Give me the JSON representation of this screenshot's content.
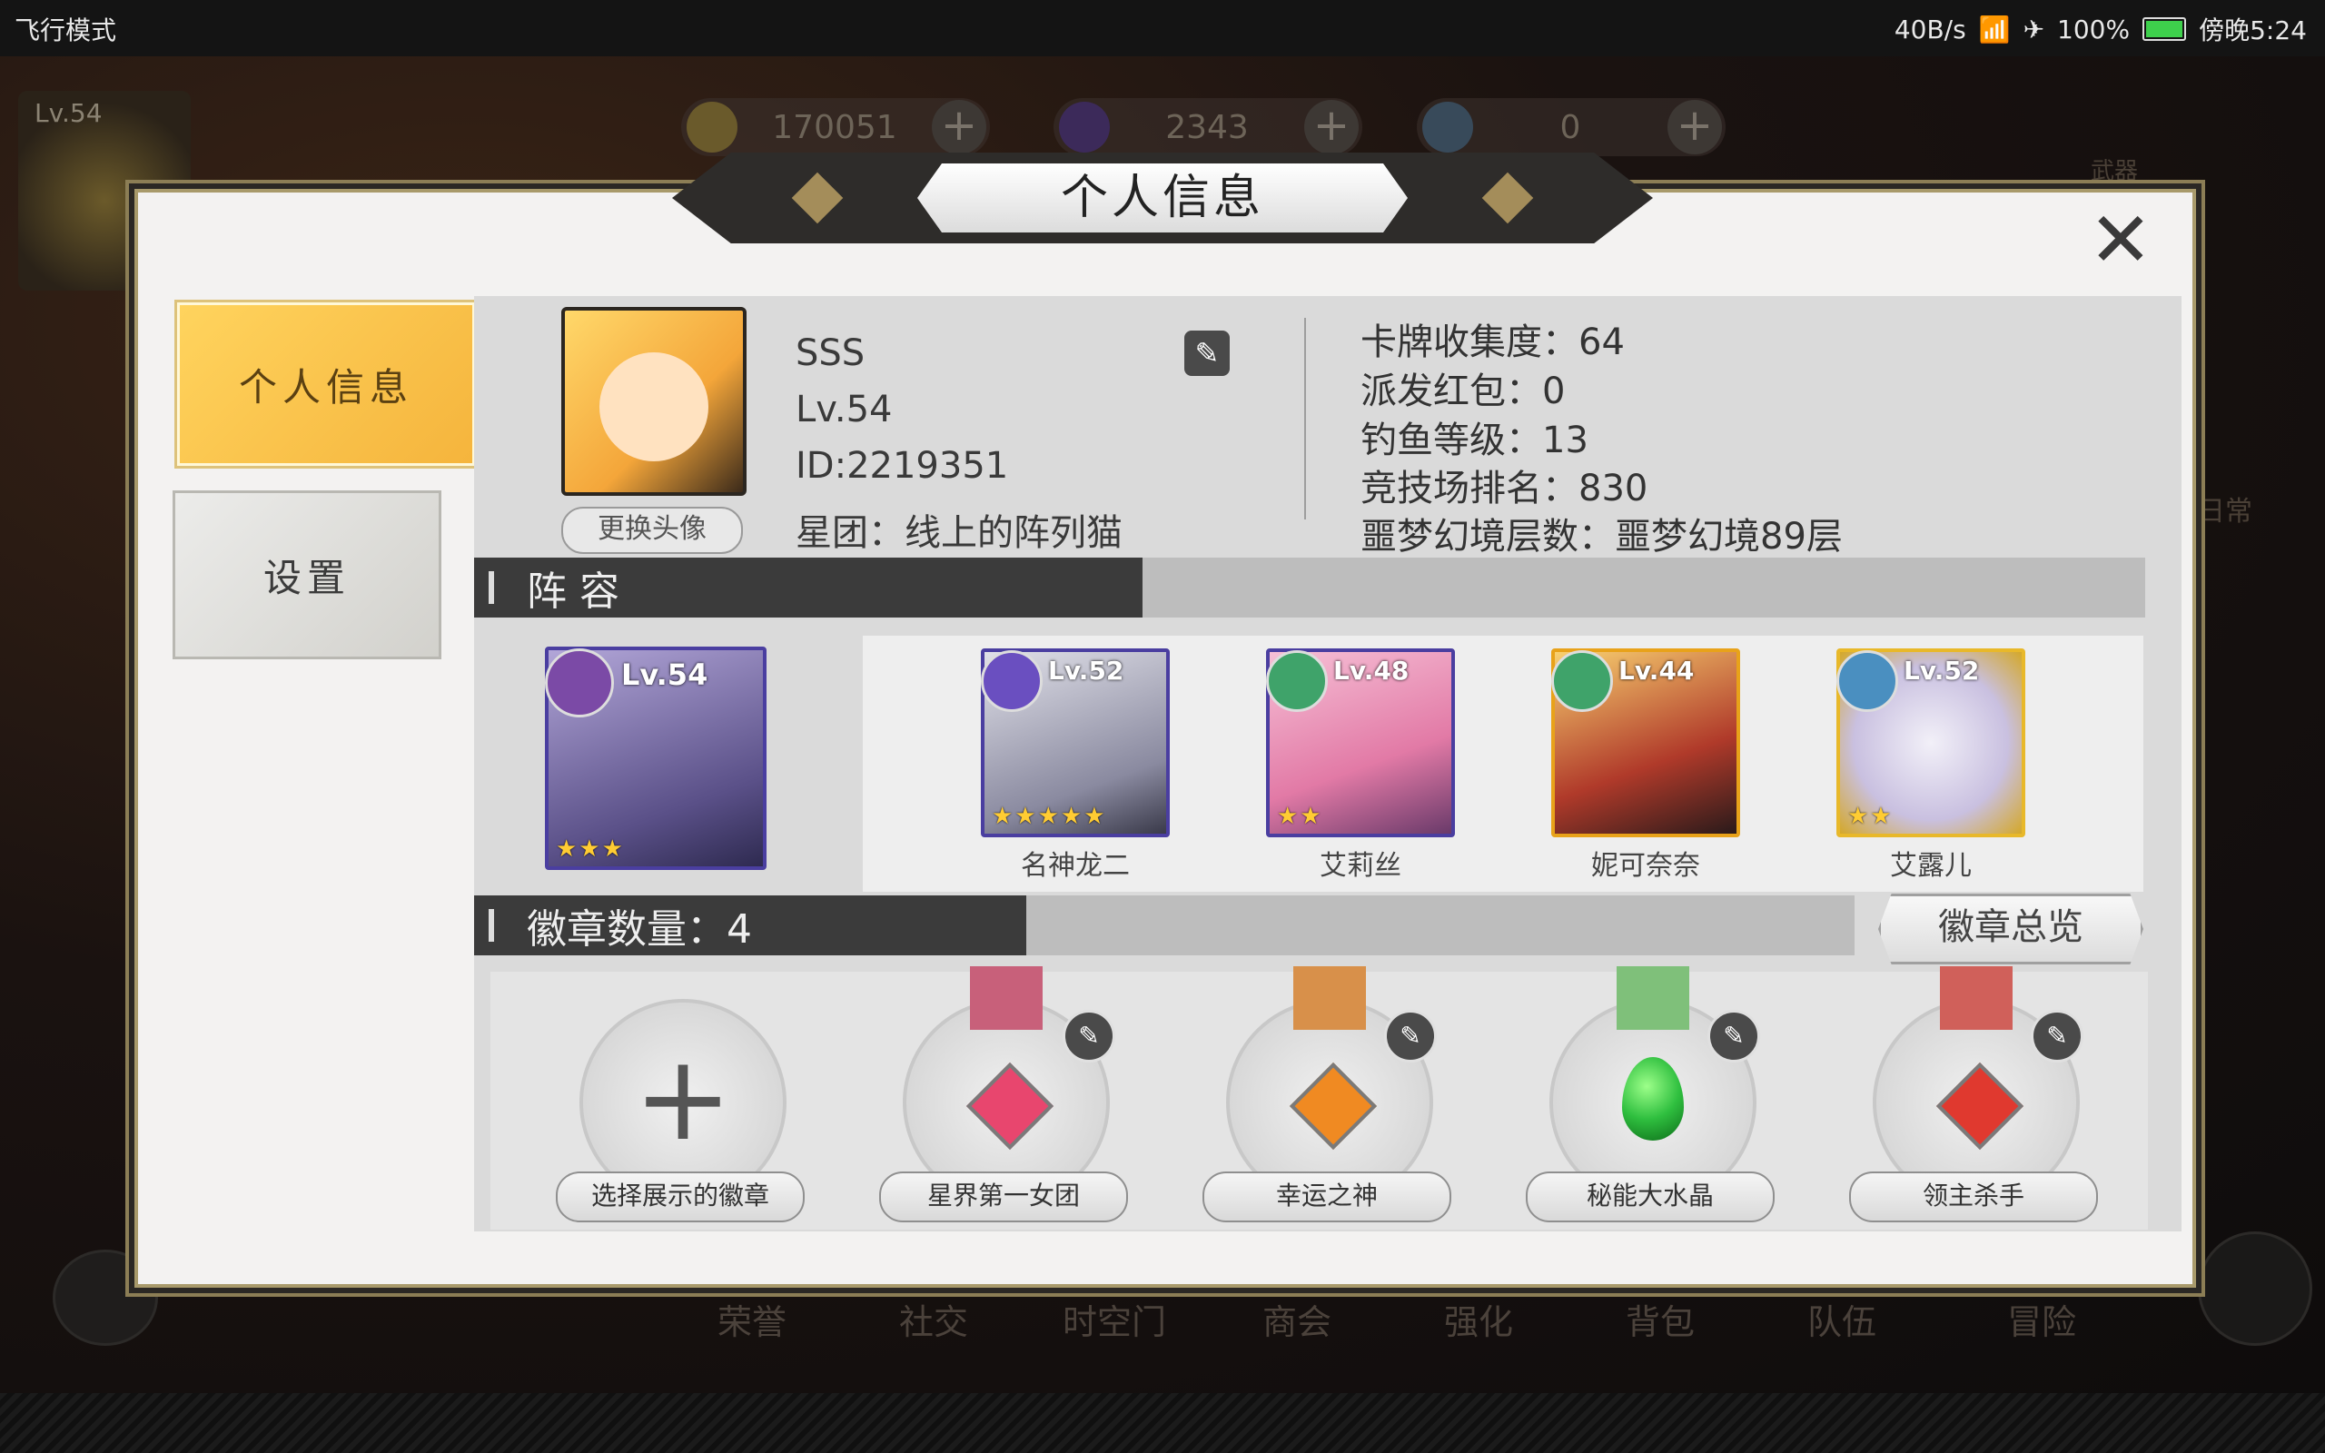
{
  "status_bar": {
    "mode": "飞行模式",
    "net": "40B/s",
    "battery": "100%",
    "time": "傍晚5:24"
  },
  "resources": [
    {
      "value": "170051",
      "icon": "gold-coin-icon"
    },
    {
      "value": "2343",
      "icon": "purple-crystal-icon"
    },
    {
      "value": "0",
      "icon": "rainbow-orb-icon"
    }
  ],
  "player_corner": {
    "level": "Lv.54"
  },
  "background_nav": [
    "荣誉",
    "社交",
    "时空门",
    "商会",
    "强化",
    "背包",
    "队伍",
    "冒险"
  ],
  "background_side": {
    "daily": "日常",
    "weapon": "武器"
  },
  "panel": {
    "title": "个人信息"
  },
  "tabs": [
    {
      "label": "个人信息"
    },
    {
      "label": "设置"
    }
  ],
  "profile": {
    "name": "SSS",
    "level": "Lv.54",
    "id": "ID:2219351",
    "guild": "星团：线上的阵列猫",
    "change_avatar": "更换头像"
  },
  "stats": [
    "卡牌收集度：64",
    "派发红包：0",
    "钓鱼等级：13",
    "竞技场排名：830",
    "噩梦幻境层数：噩梦幻境89层"
  ],
  "lineup": {
    "header": "阵 容",
    "leader": {
      "level": "Lv.54",
      "stars": "★★★",
      "class_color": "#8a4fb0"
    },
    "heroes": [
      {
        "level": "Lv.52",
        "name": "名神龙二",
        "stars": "★★★★★",
        "class_color": "#6a4fc0"
      },
      {
        "level": "Lv.48",
        "name": "艾莉丝",
        "stars": "★★",
        "class_color": "#3fa36a"
      },
      {
        "level": "Lv.44",
        "name": "妮可奈奈",
        "stars": "",
        "class_color": "#3fa36a"
      },
      {
        "level": "Lv.52",
        "name": "艾露儿",
        "stars": "★★",
        "class_color": "#4a8fc0"
      }
    ]
  },
  "badges": {
    "header": "徽章数量：4",
    "overview_button": "徽章总览",
    "items": [
      {
        "label": "选择展示的徽章",
        "gem_color": "",
        "icon": "plus-icon"
      },
      {
        "label": "星界第一女团",
        "gem_color": "#e8466e",
        "icon": "pink-star-medal-icon"
      },
      {
        "label": "幸运之神",
        "gem_color": "#f08a22",
        "icon": "orange-gem-medal-icon"
      },
      {
        "label": "秘能大水晶",
        "gem_color": "#2fbf3f",
        "icon": "green-gem-medal-icon"
      },
      {
        "label": "领主杀手",
        "gem_color": "#e0392f",
        "icon": "red-gem-medal-icon"
      }
    ]
  }
}
